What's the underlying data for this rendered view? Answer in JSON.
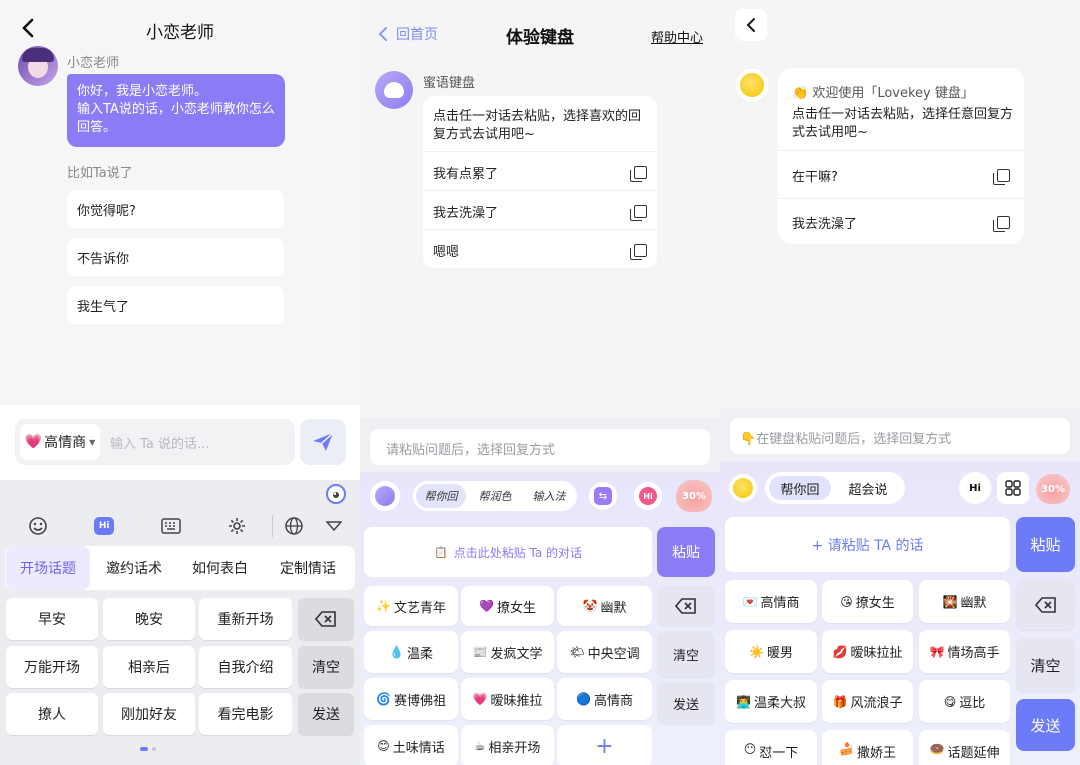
{
  "p1": {
    "title": "小恋老师",
    "teacher_name": "小恋老师",
    "greeting": "你好，我是小恋老师。\n输入TA说的话，小恋老师教你怎么回答。",
    "example_label": "比如Ta说了",
    "examples": [
      "你觉得呢?",
      "不告诉你",
      "我生气了"
    ],
    "mode_label": "高情商",
    "input_placeholder": "输入 Ta 说的话...",
    "kb_badge": "Hi",
    "tabs": [
      "开场话题",
      "邀约话术",
      "如何表白",
      "定制情话"
    ],
    "keys": [
      "早安",
      "晚安",
      "重新开场",
      "万能开场",
      "相亲后",
      "自我介绍",
      "撩人",
      "刚加好友",
      "看完电影"
    ],
    "clear": "清空",
    "send": "发送"
  },
  "p2": {
    "back_label": "回首页",
    "title": "体验键盘",
    "help": "帮助中心",
    "bot_name": "蜜语键盘",
    "intro": "点击任一对话去粘贴，选择喜欢的回复方式去试用吧~",
    "items": [
      "我有点累了",
      "我去洗澡了",
      "嗯嗯"
    ],
    "input_placeholder": "请粘贴问题后，选择回复方式",
    "tabs": [
      "帮你回",
      "帮润色",
      "输入法"
    ],
    "badge_hi": "Hi",
    "percent": "30%",
    "paste_hint": "点击此处粘贴 Ta 的对话",
    "paste": "粘贴",
    "styles": [
      {
        "icon": "✨",
        "label": "文艺青年"
      },
      {
        "icon": "💜",
        "label": "撩女生"
      },
      {
        "icon": "🤡",
        "label": "幽默"
      },
      {
        "icon": "💧",
        "label": "温柔"
      },
      {
        "icon": "📰",
        "label": "发疯文学"
      },
      {
        "icon": "🌤",
        "label": "中央空调"
      },
      {
        "icon": "🌀",
        "label": "赛博佛祖"
      },
      {
        "icon": "💗",
        "label": "暧昧推拉"
      },
      {
        "icon": "🔵",
        "label": "高情商"
      },
      {
        "icon": "😊",
        "label": "土味情话"
      },
      {
        "icon": "☕",
        "label": "相亲开场"
      }
    ],
    "plus": "+",
    "clear": "清空",
    "send": "发送"
  },
  "p3": {
    "welcome": "欢迎使用「Lovekey 键盘」",
    "intro": "点击任一对话去粘贴，选择任意回复方式去试用吧~",
    "items": [
      "在干嘛?",
      "我去洗澡了"
    ],
    "input_placeholder": "在键盘粘贴问题后，选择回复方式",
    "tabs": [
      "帮你回",
      "超会说"
    ],
    "badge_hi": "Hi",
    "percent": "30%",
    "paste_hint": "+ 请粘贴 TA 的话",
    "paste": "粘贴",
    "styles": [
      {
        "icon": "💌",
        "label": "高情商"
      },
      {
        "icon": "😘",
        "label": "撩女生"
      },
      {
        "icon": "🎇",
        "label": "幽默"
      },
      {
        "icon": "☀️",
        "label": "暖男"
      },
      {
        "icon": "💋",
        "label": "暧昧拉扯"
      },
      {
        "icon": "🎀",
        "label": "情场高手"
      },
      {
        "icon": "👨‍💻",
        "label": "温柔大叔"
      },
      {
        "icon": "🎁",
        "label": "风流浪子"
      },
      {
        "icon": "😋",
        "label": "逗比"
      },
      {
        "icon": "😶",
        "label": "怼一下"
      },
      {
        "icon": "🍰",
        "label": "撒娇王"
      },
      {
        "icon": "🍩",
        "label": "话题延伸"
      }
    ],
    "clear": "清空",
    "send": "发送"
  },
  "colors": {
    "accent": "#8b7cf6",
    "accent_dark": "#6f64f2",
    "send_blue": "#6c7cf8"
  }
}
